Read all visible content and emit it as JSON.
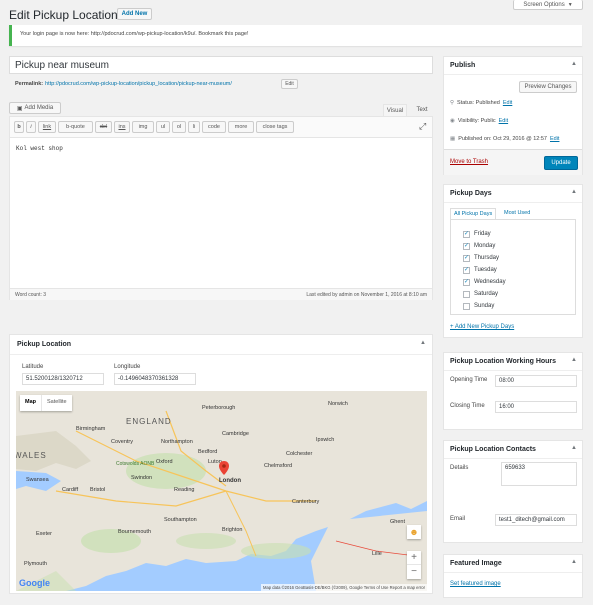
{
  "header": {
    "screen_options": "Screen Options",
    "screen_options_icon": "caret-down-icon",
    "title": "Edit Pickup Location",
    "add_new": "Add New"
  },
  "notice": {
    "text": "Your login page is now here: http://pdocrud.com/wp-pickup-location/k9u/. Bookmark this page!"
  },
  "post": {
    "title": "Pickup near museum",
    "permalink_label": "Permalink:",
    "permalink_url": "http://pdocrud.com/wp-pickup-location/pickup_location/pickup-near-museum/",
    "edit_button": "Edit"
  },
  "editor": {
    "add_media": "Add Media",
    "tab_visual": "Visual",
    "tab_text": "Text",
    "quicktags": [
      "b",
      "i",
      "link",
      "b-quote",
      "del",
      "ins",
      "img",
      "ul",
      "ol",
      "li",
      "code",
      "more",
      "close tags"
    ],
    "content": "Kol west shop",
    "word_count": "Word count: 3",
    "last_edited": "Last edited by admin on November 1, 2016 at 8:10 am"
  },
  "pickup_location_box": {
    "title": "Pickup Location",
    "latitude_label": "Latitude",
    "latitude_value": "51.5200128/1320712",
    "longitude_label": "Longitude",
    "longitude_value": "-0.1496048370361328",
    "map_tab": "Map",
    "satellite_tab": "Satellite",
    "country_label": "ENGLAND",
    "wales_label": "WALES",
    "marker_label": "London",
    "google_logo": "Google",
    "attribution": "Map data ©2016 GeoBasis-DE/BKG (©2009), Google   Terms of Use   Report a map error",
    "zoom_in": "+",
    "zoom_out": "−",
    "cities": [
      "Birmingham",
      "Peterborough",
      "Norwich",
      "Cambridge",
      "Ipswich",
      "Coventry",
      "Northampton",
      "Bedford",
      "Colchester",
      "Oxford",
      "Luton",
      "Chelmsford",
      "Swindon",
      "Reading",
      "London",
      "Bristol",
      "Cardiff",
      "Southampton",
      "Brighton",
      "Bournemouth",
      "Ghent",
      "Lille",
      "Canterbury",
      "Exeter",
      "Plymouth",
      "Swansea",
      "Cotswolds AONB"
    ]
  },
  "publish": {
    "title": "Publish",
    "preview_changes": "Preview Changes",
    "status": "Status: Published",
    "status_edit": "Edit",
    "visibility": "Visibility: Public",
    "visibility_edit": "Edit",
    "published_on": "Published on: Oct 29, 2016 @ 12:57",
    "published_edit": "Edit",
    "move_to_trash": "Move to Trash",
    "update": "Update"
  },
  "pickup_days": {
    "title": "Pickup Days",
    "tab_all": "All Pickup Days",
    "tab_most_used": "Most Used",
    "days": [
      {
        "label": "Friday",
        "checked": true
      },
      {
        "label": "Monday",
        "checked": true
      },
      {
        "label": "Thursday",
        "checked": true
      },
      {
        "label": "Tuesday",
        "checked": true
      },
      {
        "label": "Wednesday",
        "checked": true
      },
      {
        "label": "Saturday",
        "checked": false
      },
      {
        "label": "Sunday",
        "checked": false
      }
    ],
    "add_new": "+ Add New Pickup Days"
  },
  "working_hours": {
    "title": "Pickup Location Working Hours",
    "opening_label": "Opening Time",
    "opening_value": "08:00",
    "closing_label": "Closing Time",
    "closing_value": "16:00"
  },
  "contacts": {
    "title": "Pickup Location Contacts",
    "details_label": "Details",
    "details_value": "659633",
    "email_label": "Email",
    "email_value": "test1_ditech@gmail.com"
  },
  "featured_image": {
    "title": "Featured Image",
    "set_link": "Set featured image"
  },
  "colors": {
    "primary": "#0085ba",
    "link": "#0073aa",
    "trash": "#a00",
    "notice_border": "#46b450",
    "map_water": "#a3ccff",
    "map_land": "#e8e4da",
    "map_green": "#c8dfb0",
    "marker": "#ea4335"
  }
}
